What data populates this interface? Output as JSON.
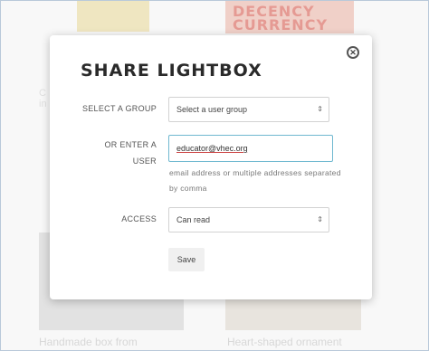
{
  "background": {
    "book_red_text": "DECENCY CURRENCY",
    "side_text_line1": "C",
    "side_text_line2": "in",
    "caption_left": "Handmade box from",
    "caption_right": "Heart-shaped ornament"
  },
  "modal": {
    "title": "SHARE LIGHTBOX",
    "close_glyph": "✕",
    "group_label": "SELECT A GROUP",
    "group_select_value": "Select a user group",
    "user_label_line1": "OR ENTER A",
    "user_label_line2": "USER",
    "user_input_value": "educator@vhec.org",
    "hint": "email address or multiple addresses separated by comma",
    "access_label": "ACCESS",
    "access_select_value": "Can read",
    "select_arrow_glyph": "⇕",
    "save_label": "Save"
  }
}
